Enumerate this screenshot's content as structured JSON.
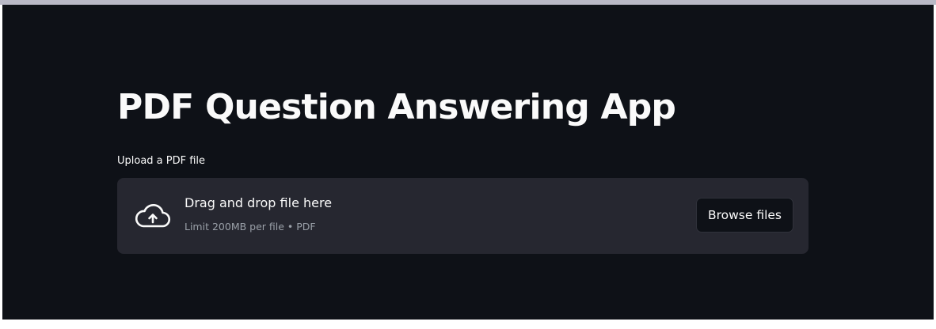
{
  "app": {
    "title": "PDF Question Answering App"
  },
  "uploader": {
    "label": "Upload a PDF file",
    "dropzone_title": "Drag and drop file here",
    "dropzone_subtitle": "Limit 200MB per file • PDF",
    "browse_button_label": "Browse files",
    "icon": "cloud-upload-icon"
  },
  "colors": {
    "background": "#0e1117",
    "dropzone_background": "#262730",
    "text_primary": "#fafafa",
    "text_secondary": "#9aa0a8"
  }
}
